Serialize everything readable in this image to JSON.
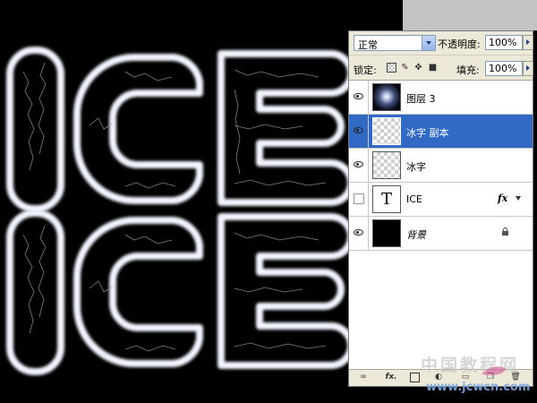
{
  "canvas": {
    "text_top": "ICE",
    "text_bottom": "ICE",
    "background": "#000000"
  },
  "options": {
    "blend_mode": "正常",
    "opacity_label": "不透明度:",
    "opacity_value": "100%",
    "lock_label": "锁定:",
    "fill_label": "填充:",
    "fill_value": "100%"
  },
  "layers": [
    {
      "name": "图层 3",
      "visible": true,
      "selected": false,
      "thumb": "radial-gradient"
    },
    {
      "name": "冰字 副本",
      "visible": true,
      "selected": true,
      "thumb": "transparent"
    },
    {
      "name": "冰字",
      "visible": true,
      "selected": false,
      "thumb": "transparent"
    },
    {
      "name": "ICE",
      "visible": false,
      "selected": false,
      "thumb": "text",
      "thumb_glyph": "T",
      "effects": "fx"
    },
    {
      "name": "背景",
      "visible": true,
      "selected": false,
      "thumb": "black",
      "locked": true
    }
  ],
  "bottom_icons": [
    "link-icon",
    "fx-icon",
    "mask-icon",
    "adjustment-icon",
    "folder-icon",
    "new-layer-icon",
    "trash-icon"
  ],
  "bottom_fx_label": "fx.",
  "watermark": {
    "line1": "中国教程网",
    "line2": "www.jcwcn.com"
  },
  "colors": {
    "selection": "#316ac5",
    "panel_bg": "#ece9d8",
    "ice_glow": "#ffffff"
  }
}
